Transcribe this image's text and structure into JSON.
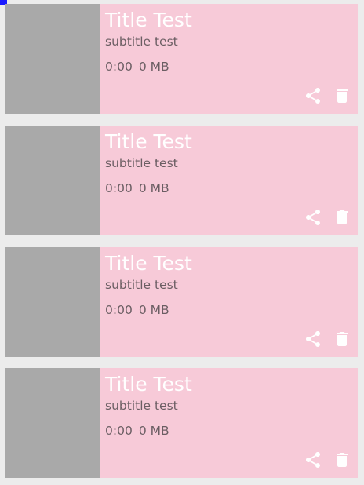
{
  "colors": {
    "card_background": "#f7cad8",
    "thumbnail_placeholder": "#a9a9a9",
    "title_text": "#ffffff",
    "secondary_text": "#6b5e63",
    "icon": "#ffffff"
  },
  "items": [
    {
      "title": "Title Test",
      "subtitle": "subtitle test",
      "duration": "0:00",
      "size": "0 MB",
      "actions": [
        "share-icon",
        "trash-icon"
      ]
    },
    {
      "title": "Title Test",
      "subtitle": "subtitle test",
      "duration": "0:00",
      "size": "0 MB",
      "actions": [
        "share-icon",
        "trash-icon"
      ]
    },
    {
      "title": "Title Test",
      "subtitle": "subtitle test",
      "duration": "0:00",
      "size": "0 MB",
      "actions": [
        "share-icon",
        "trash-icon"
      ]
    },
    {
      "title": "Title Test",
      "subtitle": "subtitle test",
      "duration": "0:00",
      "size": "0 MB",
      "actions": [
        "share-icon",
        "trash-icon"
      ]
    }
  ]
}
